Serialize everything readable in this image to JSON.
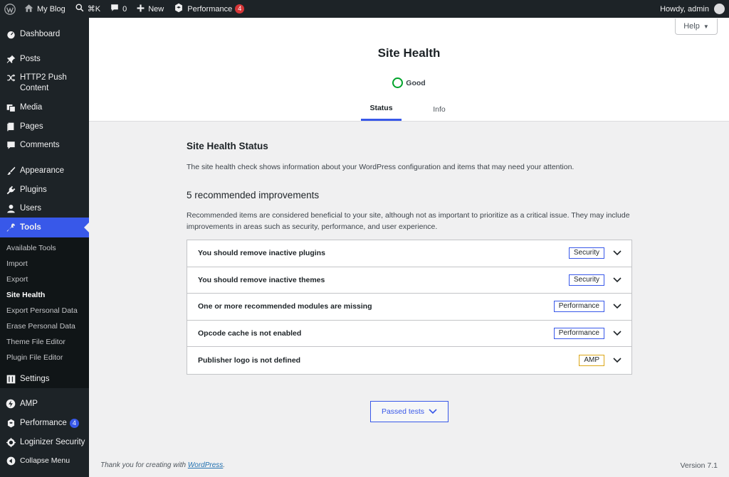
{
  "adminbar": {
    "site_name": "My Blog",
    "shortcut": "⌘K",
    "comments_count": "0",
    "new_label": "New",
    "performance_label": "Performance",
    "performance_count": "4",
    "greeting": "Howdy, admin"
  },
  "sidebar": {
    "dashboard": "Dashboard",
    "posts": "Posts",
    "http2": "HTTP2 Push Content",
    "media": "Media",
    "pages": "Pages",
    "comments": "Comments",
    "appearance": "Appearance",
    "plugins": "Plugins",
    "users": "Users",
    "tools": "Tools",
    "submenu": [
      "Available Tools",
      "Import",
      "Export",
      "Site Health",
      "Export Personal Data",
      "Erase Personal Data",
      "Theme File Editor",
      "Plugin File Editor"
    ],
    "settings": "Settings",
    "amp": "AMP",
    "performance": "Performance",
    "performance_count": "4",
    "loginizer": "Loginizer Security",
    "collapse": "Collapse Menu"
  },
  "header": {
    "help": "Help",
    "title": "Site Health",
    "status": "Good",
    "tabs": [
      "Status",
      "Info"
    ]
  },
  "main": {
    "section_title": "Site Health Status",
    "section_desc": "The site health check shows information about your WordPress configuration and items that may need your attention.",
    "issues_title": "5 recommended improvements",
    "issues_desc": "Recommended items are considered beneficial to your site, although not as important to prioritize as a critical issue. They may include improvements in areas such as security, performance, and user experience.",
    "issues": [
      {
        "label": "You should remove inactive plugins",
        "badge": "Security"
      },
      {
        "label": "You should remove inactive themes",
        "badge": "Security"
      },
      {
        "label": "One or more recommended modules are missing",
        "badge": "Performance"
      },
      {
        "label": "Opcode cache is not enabled",
        "badge": "Performance"
      },
      {
        "label": "Publisher logo is not defined",
        "badge": "AMP"
      }
    ],
    "passed_tests": "Passed tests"
  },
  "footer": {
    "thanks_prefix": "Thank you for creating with ",
    "thanks_link": "WordPress",
    "thanks_suffix": ".",
    "version": "Version 7.1"
  },
  "colors": {
    "accent": "#3858e9",
    "good": "#00a32a",
    "amp_badge": "#dba617",
    "adminbar": "#1d2327"
  }
}
